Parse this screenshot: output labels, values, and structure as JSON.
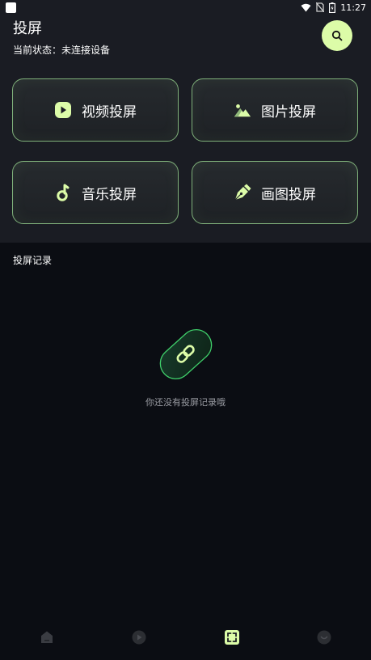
{
  "status_bar": {
    "time": "11:27"
  },
  "header": {
    "title": "投屏",
    "status_text": "当前状态：未连接设备"
  },
  "cards": [
    {
      "label": "视频投屏",
      "icon": "play-circle-icon"
    },
    {
      "label": "图片投屏",
      "icon": "image-icon"
    },
    {
      "label": "音乐投屏",
      "icon": "music-note-icon"
    },
    {
      "label": "画图投屏",
      "icon": "pen-icon"
    }
  ],
  "records": {
    "title": "投屏记录",
    "empty_text": "你还没有投屏记录哦",
    "empty_icon": "link-icon"
  },
  "bottom_nav": [
    {
      "icon": "home-icon",
      "active": false
    },
    {
      "icon": "play-icon",
      "active": false
    },
    {
      "icon": "cast-icon",
      "active": true
    },
    {
      "icon": "profile-icon",
      "active": false
    }
  ],
  "colors": {
    "accent": "#dcfca8",
    "card_border": "#7fb07a",
    "background": "#0b0d13",
    "header_bg": "#1a1c23"
  }
}
